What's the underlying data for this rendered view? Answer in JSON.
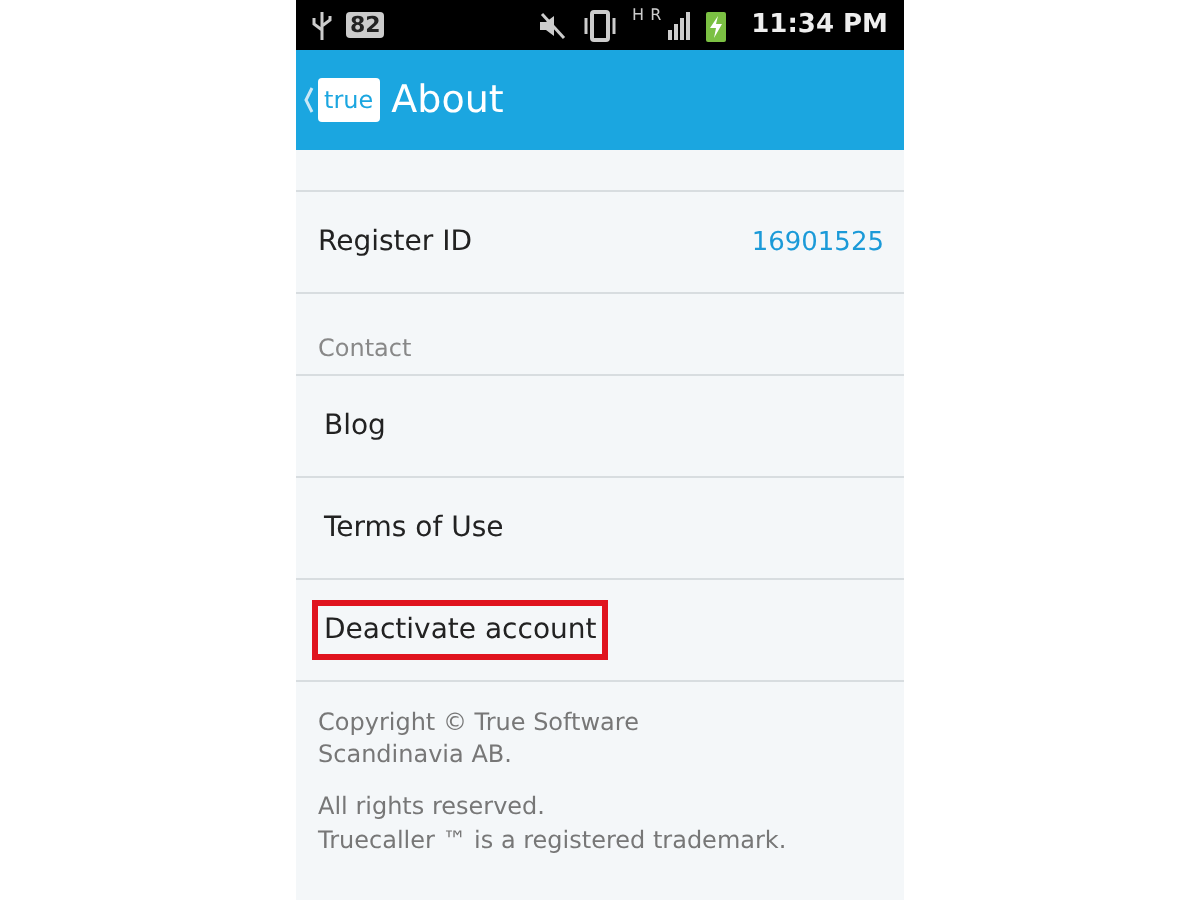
{
  "status_bar": {
    "battery_text": "82",
    "network_type": "H",
    "roaming": "R",
    "time": "11:34 PM"
  },
  "app_bar": {
    "logo": "true",
    "title": "About"
  },
  "register": {
    "label": "Register ID",
    "value": "16901525"
  },
  "section_header": "Contact",
  "items": [
    {
      "label": "Blog",
      "highlighted": false
    },
    {
      "label": "Terms of Use",
      "highlighted": false
    },
    {
      "label": "Deactivate account",
      "highlighted": true
    }
  ],
  "footer": [
    "Copyright © True Software\nScandinavia AB.",
    "All rights reserved.\nTruecaller ™ is a registered trademark."
  ]
}
